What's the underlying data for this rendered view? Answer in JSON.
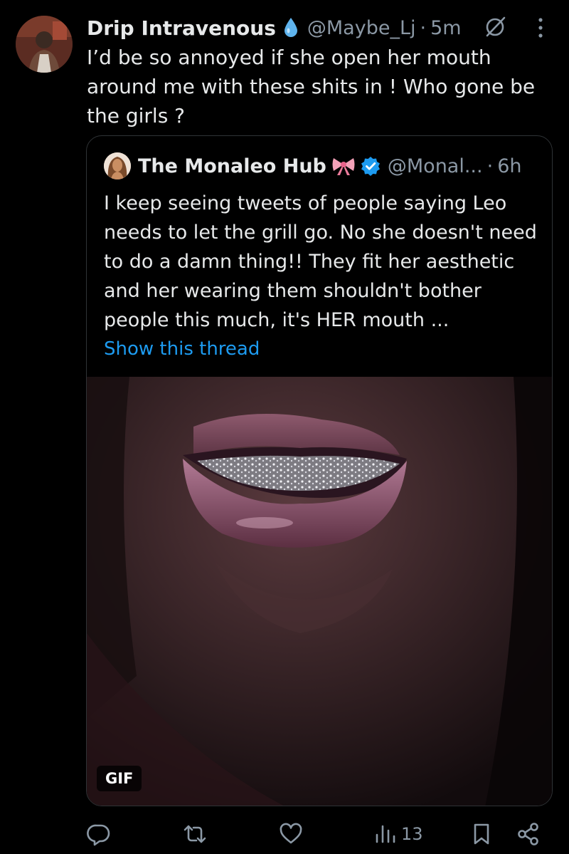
{
  "author": {
    "display_name": "Drip Intravenous",
    "handle": "@Maybe_Lj",
    "separator": "·",
    "time": "5m",
    "name_emoji_icon": "water-drop-icon"
  },
  "tweet": {
    "text": "I’d be so annoyed if she open her mouth around me with these shits in ! Who gone be the girls ?"
  },
  "quote": {
    "display_name": "The Monaleo Hub",
    "name_emoji_icon": "pink-bow-icon",
    "verified_icon": "verified-badge-icon",
    "handle": "@Monal...",
    "separator": "·",
    "time": "6h",
    "text": "I keep seeing tweets of people saying Leo needs to let the grill go. No she doesn't need to do a damn thing!! They fit her aesthetic and her wearing them shouldn't bother people this much, it's HER mouth ...",
    "show_thread": "Show this thread",
    "media_badge": "GIF"
  },
  "actions": {
    "views": "13"
  },
  "colors": {
    "background": "#000000",
    "text": "#e7e9ea",
    "muted": "#8b98a5",
    "link": "#1d9bf0",
    "border": "#2f3336",
    "verified": "#1d9bf0"
  }
}
